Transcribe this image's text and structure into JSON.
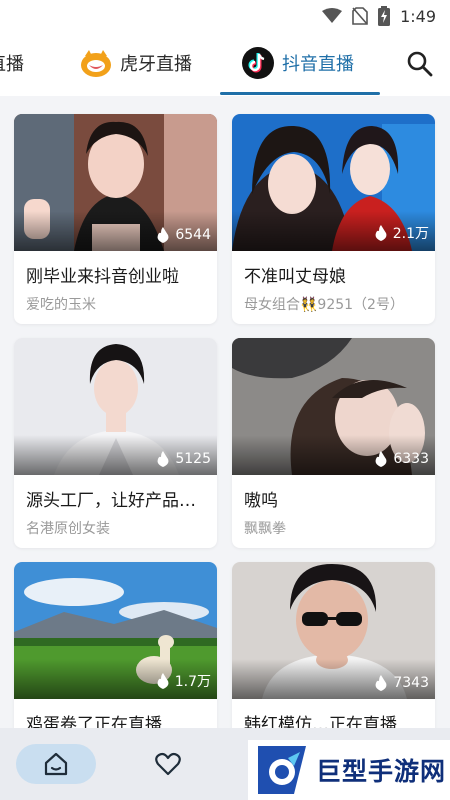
{
  "status_bar": {
    "time": "1:49"
  },
  "tabs": [
    {
      "label": "直播"
    },
    {
      "label": "虎牙直播"
    },
    {
      "label": "抖音直播",
      "active": true
    }
  ],
  "colors": {
    "accent": "#1f6fa8",
    "huya": "#f2a11a"
  },
  "cards": [
    {
      "title": "刚毕业来抖音创业啦",
      "anchor": "爱吃的玉米",
      "views": "6544"
    },
    {
      "title": "不准叫丈母娘",
      "anchor": "母女组合👯9251（2号）",
      "views": "2.1万"
    },
    {
      "title": "源头工厂，让好产品…",
      "anchor": "名港原创女装",
      "views": "5125"
    },
    {
      "title": "嗷呜",
      "anchor": "飘飘拳",
      "views": "6333"
    },
    {
      "title": "鸡蛋卷了正在直播",
      "anchor": "",
      "views": "1.7万"
    },
    {
      "title": "韩红模仿…正在直播",
      "anchor": "",
      "views": "7343"
    }
  ],
  "watermark": {
    "text": "巨型手游网"
  }
}
